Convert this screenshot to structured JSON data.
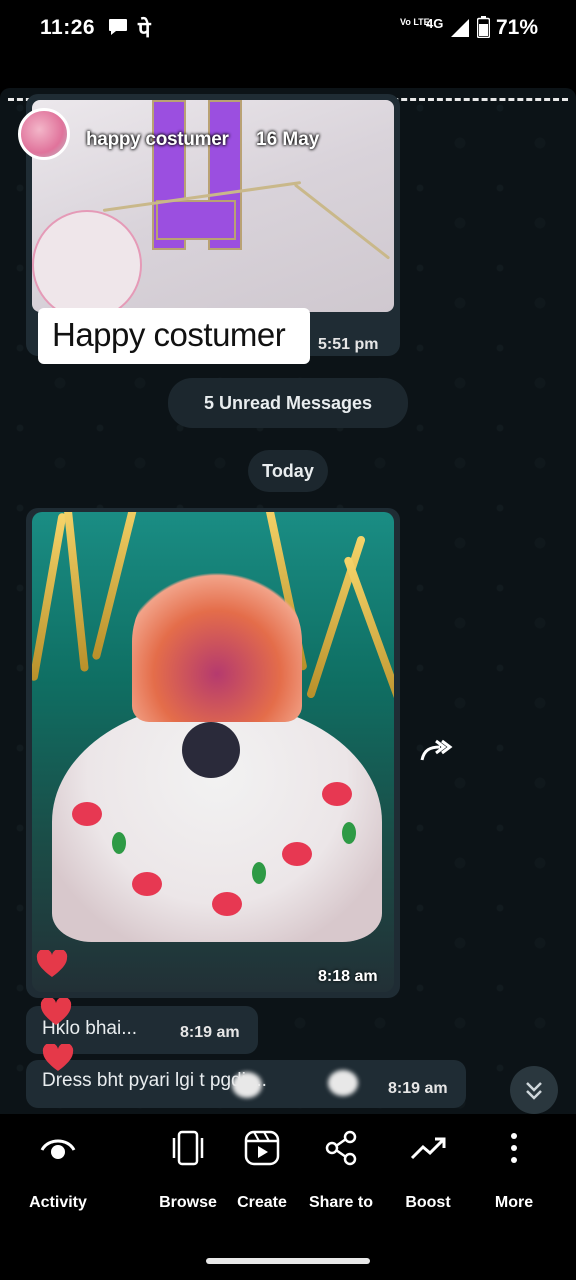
{
  "status_bar": {
    "time": "11:26",
    "app_glyph": "पे",
    "volte": "Vo LTE",
    "network": "4G",
    "battery": "71%"
  },
  "icons": [
    "message-icon",
    "signal-icon",
    "battery-icon",
    "heart-icon",
    "forward-icon",
    "chevrons-down-icon",
    "activity-icon",
    "browse-icon",
    "create-icon",
    "share-icon",
    "boost-icon",
    "more-icon"
  ],
  "colors": {
    "background": "#0c1317",
    "bubble": "#1f2c34",
    "heart": "#e53949",
    "purple_accent": "#9b4fe0"
  },
  "chat": {
    "story_reply": {
      "name": "happy costumer",
      "date": "16 May",
      "caption": "Happy costumer",
      "time": "5:51 pm"
    },
    "unread_label": "5 Unread Messages",
    "day_label": "Today",
    "image_message": {
      "time": "8:18 am"
    },
    "messages": [
      {
        "text": "Hklo bhai...",
        "time": "8:19 am"
      },
      {
        "text": "Dress bht pyari lgi    t pgdi   ...",
        "time": "8:19 am"
      }
    ]
  },
  "bottom_nav": {
    "items": [
      {
        "label": "Activity"
      },
      {
        "label": "Browse"
      },
      {
        "label": "Create"
      },
      {
        "label": "Share to"
      },
      {
        "label": "Boost"
      },
      {
        "label": "More"
      }
    ]
  }
}
